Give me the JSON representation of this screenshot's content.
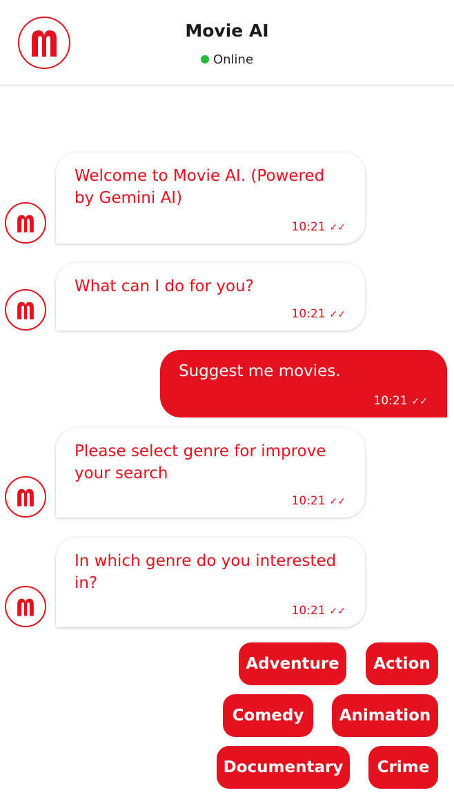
{
  "header": {
    "title": "Movie AI",
    "status": "Online",
    "logo_icon": "movie-ai-logo-icon"
  },
  "messages": [
    {
      "from": "bot",
      "text": "Welcome to Movie AI. (Powered by Gemini AI)",
      "time": "10:21"
    },
    {
      "from": "bot",
      "text": "What can I do for you?",
      "time": "10:21"
    },
    {
      "from": "user",
      "text": "Suggest me movies.",
      "time": "10:21"
    },
    {
      "from": "bot",
      "text": "Please select genre for improve your search",
      "time": "10:21"
    },
    {
      "from": "bot",
      "text": "In which genre do you interested in?",
      "time": "10:21"
    }
  ],
  "genres": [
    "Adventure",
    "Action",
    "Comedy",
    "Animation",
    "Documentary",
    "Crime"
  ],
  "colors": {
    "accent": "#e3121e",
    "online": "#27b53a"
  }
}
